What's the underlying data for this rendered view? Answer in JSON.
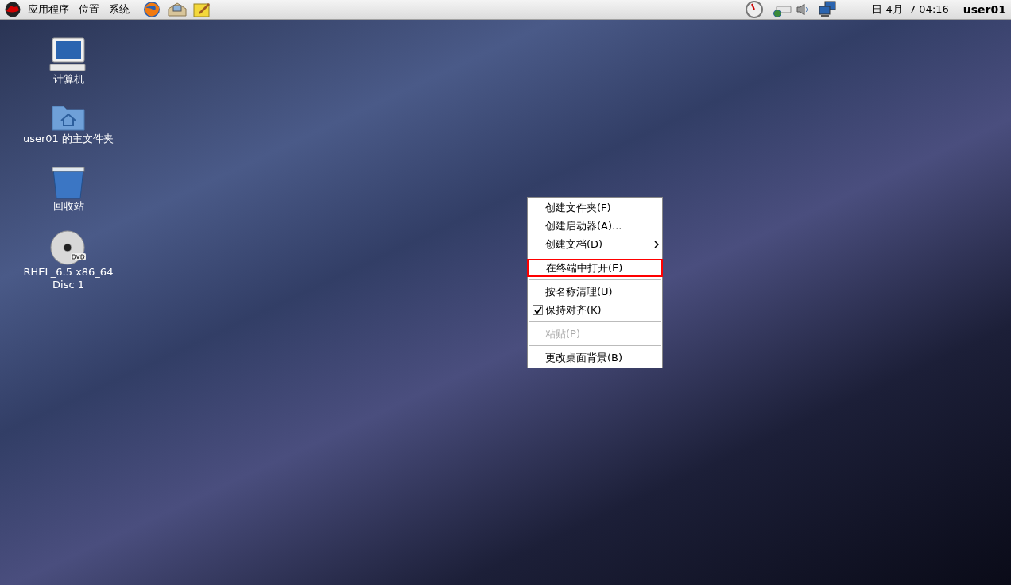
{
  "top_panel": {
    "menus": [
      "应用程序",
      "位置",
      "系统"
    ],
    "clock": "日 4月  7 04:16",
    "user": "user01"
  },
  "desktop_icons": [
    {
      "kind": "computer",
      "label": "计算机"
    },
    {
      "kind": "home",
      "label": "user01 的主文件夹"
    },
    {
      "kind": "trash",
      "label": "回收站"
    },
    {
      "kind": "dvd",
      "label": "RHEL_6.5 x86_64\nDisc 1"
    }
  ],
  "context_menu": [
    {
      "kind": "item",
      "label": "创建文件夹(F)",
      "submenu": false,
      "highlighted": false,
      "disabled": false,
      "checked": false
    },
    {
      "kind": "item",
      "label": "创建启动器(A)...",
      "submenu": false,
      "highlighted": false,
      "disabled": false,
      "checked": false
    },
    {
      "kind": "item",
      "label": "创建文档(D)",
      "submenu": true,
      "highlighted": false,
      "disabled": false,
      "checked": false
    },
    {
      "kind": "separator"
    },
    {
      "kind": "item",
      "label": "在终端中打开(E)",
      "submenu": false,
      "highlighted": true,
      "disabled": false,
      "checked": false
    },
    {
      "kind": "separator"
    },
    {
      "kind": "item",
      "label": "按名称清理(U)",
      "submenu": false,
      "highlighted": false,
      "disabled": false,
      "checked": false
    },
    {
      "kind": "check",
      "label": "保持对齐(K)",
      "submenu": false,
      "highlighted": false,
      "disabled": false,
      "checked": true
    },
    {
      "kind": "separator"
    },
    {
      "kind": "item",
      "label": "粘贴(P)",
      "submenu": false,
      "highlighted": false,
      "disabled": true,
      "checked": false
    },
    {
      "kind": "separator"
    },
    {
      "kind": "item",
      "label": "更改桌面背景(B)",
      "submenu": false,
      "highlighted": false,
      "disabled": false,
      "checked": false
    }
  ]
}
